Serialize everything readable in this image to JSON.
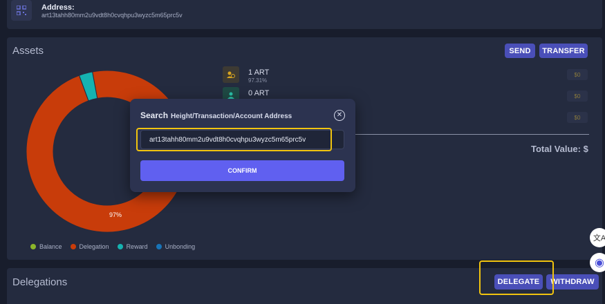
{
  "address_card": {
    "label": "Address:",
    "value": "art13tahh80mm2u9vdt8h0cvqhpu3wyzc5m65prc5v"
  },
  "assets": {
    "title": "Assets",
    "send_label": "SEND",
    "transfer_label": "TRANSFER",
    "rows": [
      {
        "amount": "1 ART",
        "percent": "97.31%",
        "value": "$0",
        "icon": "delegation-icon"
      },
      {
        "amount": "0 ART",
        "percent": "",
        "value": "$0",
        "icon": "reward-icon"
      },
      {
        "amount": "",
        "percent": "",
        "value": "$0",
        "icon": ""
      }
    ],
    "total_label": "Total Value: $",
    "donut_label": "97%"
  },
  "legend": [
    {
      "label": "Balance",
      "color": "#8bb52a"
    },
    {
      "label": "Delegation",
      "color": "#c83c0a"
    },
    {
      "label": "Reward",
      "color": "#15b2b0"
    },
    {
      "label": "Unbonding",
      "color": "#1874b8"
    }
  ],
  "chart_data": {
    "type": "pie",
    "categories": [
      "Balance",
      "Delegation",
      "Reward",
      "Unbonding"
    ],
    "values": [
      0,
      97.31,
      2.69,
      0
    ],
    "colors": [
      "#8bb52a",
      "#c83c0a",
      "#15b2b0",
      "#1874b8"
    ],
    "data_labels": [
      "97%"
    ]
  },
  "delegations": {
    "title": "Delegations",
    "delegate_label": "DELEGATE",
    "withdraw_label": "WITHDRAW"
  },
  "modal": {
    "title": "Search",
    "subtitle": "Height/Transaction/Account Address",
    "input_value": "art13tahh80mm2u9vdt8h0cvqhpu3wyzc5m65prc5v",
    "confirm_label": "CONFIRM",
    "close_glyph": "✕"
  },
  "floating": {
    "translate_glyph": "文A",
    "assistant_glyph": "◉"
  }
}
